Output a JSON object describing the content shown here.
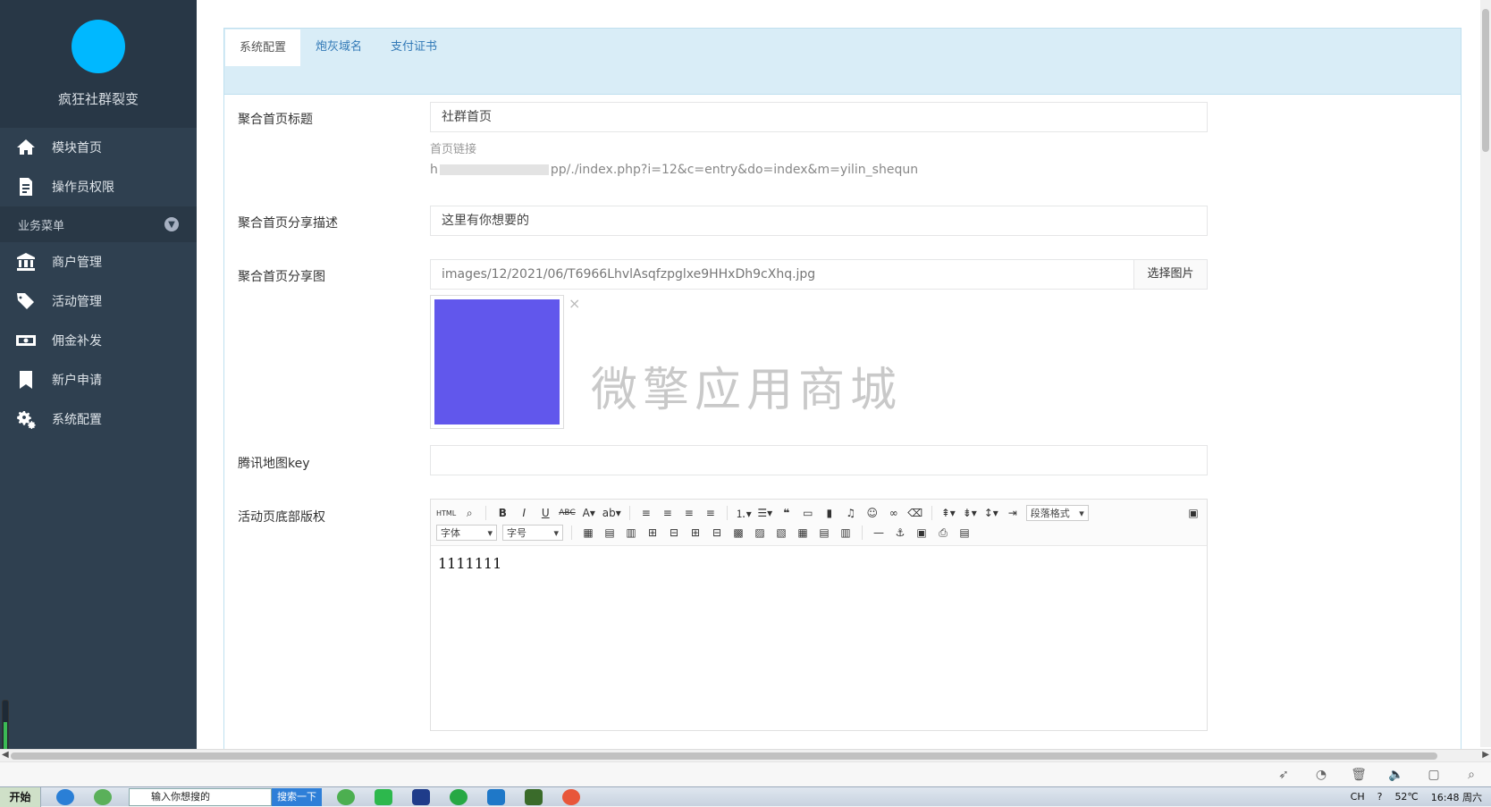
{
  "sidebar": {
    "app_name": "疯狂社群裂变",
    "logo_color": "#00b8ff",
    "top_items": [
      {
        "label": "模块首页",
        "icon": "home-icon"
      },
      {
        "label": "操作员权限",
        "icon": "document-icon"
      }
    ],
    "section_title": "业务菜单",
    "items": [
      {
        "label": "商户管理",
        "icon": "bank-icon"
      },
      {
        "label": "活动管理",
        "icon": "tags-icon"
      },
      {
        "label": "佣金补发",
        "icon": "money-icon"
      },
      {
        "label": "新户申请",
        "icon": "bookmark-icon"
      },
      {
        "label": "系统配置",
        "icon": "gears-icon"
      }
    ]
  },
  "tabs": [
    {
      "label": "系统配置",
      "active": true
    },
    {
      "label": "炮灰域名",
      "active": false
    },
    {
      "label": "支付证书",
      "active": false
    }
  ],
  "form": {
    "home_title": {
      "label": "聚合首页标题",
      "value": "社群首页"
    },
    "home_link": {
      "label": "首页链接",
      "prefix": "h",
      "suffix": "pp/./index.php?i=12&c=entry&do=index&m=yilin_shequn"
    },
    "share_desc": {
      "label": "聚合首页分享描述",
      "value": "这里有你想要的"
    },
    "share_image": {
      "label": "聚合首页分享图",
      "value": "images/12/2021/06/T6966LhvlAsqfzpglxe9HHxDh9cXhq.jpg",
      "button": "选择图片",
      "preview_color": "#6157ec",
      "close": "×"
    },
    "watermark": "微擎应用商城",
    "map_key": {
      "label": "腾讯地图key",
      "value": ""
    },
    "footer_copyright": {
      "label": "活动页底部版权",
      "content": "1111111"
    }
  },
  "editor": {
    "row1": [
      "html",
      "zoom",
      "B",
      "I",
      "U",
      "abc",
      "A",
      "ab",
      "align-left",
      "align-center",
      "align-right",
      "justify",
      "ol",
      "ul",
      "quote",
      "code",
      "page",
      "music",
      "emotion",
      "link",
      "eraser",
      "row-spacing",
      "para-spacing",
      "line-height",
      "indent"
    ],
    "paragraph_format": "段落格式",
    "font_family": "字体",
    "font_size": "字号"
  },
  "taskbar": {
    "start": "开始",
    "search_placeholder": "输入你想搜的",
    "search_button": "搜索一下",
    "lang": "CH",
    "temp": "52℃",
    "time": "16:48 周六"
  },
  "progress_fraction": 0.55
}
